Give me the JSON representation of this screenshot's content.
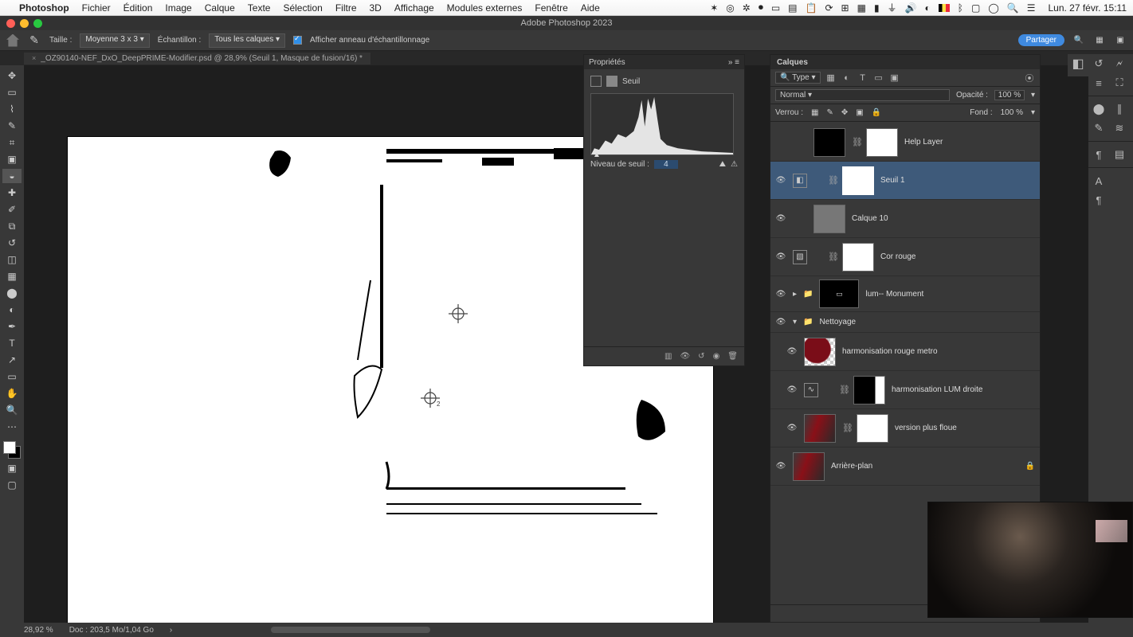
{
  "menubar": {
    "app": "Photoshop",
    "items": [
      "Fichier",
      "Édition",
      "Image",
      "Calque",
      "Texte",
      "Sélection",
      "Filtre",
      "3D",
      "Affichage",
      "Modules externes",
      "Fenêtre",
      "Aide"
    ],
    "clock": "Lun. 27 févr. 15:11"
  },
  "app_title": "Adobe Photoshop 2023",
  "optbar": {
    "taille_label": "Taille :",
    "taille_value": "Moyenne 3 x 3",
    "echant_label": "Échantillon :",
    "echant_value": "Tous les calques",
    "ring_label": "Afficher anneau d'échantillonnage",
    "share": "Partager"
  },
  "doc_tab": "_OZ90140-NEF_DxO_DeepPRIME-Modifier.psd @ 28,9% (Seuil 1, Masque de fusion/16) *",
  "status": {
    "zoom": "28,92 %",
    "doc": "Doc : 203,5 Mo/1,04 Go"
  },
  "props": {
    "title": "Propriétés",
    "adj_name": "Seuil",
    "thr_label": "Niveau de seuil :",
    "thr_value": "4"
  },
  "layers": {
    "title": "Calques",
    "type_label": "Type",
    "blend": "Normal",
    "opacity_label": "Opacité :",
    "opacity_value": "100 %",
    "lock_label": "Verrou :",
    "fill_label": "Fond :",
    "fill_value": "100 %",
    "items": [
      {
        "name": "Help Layer",
        "vis": false,
        "adj": false,
        "mask": true,
        "thumb": "black"
      },
      {
        "name": "Seuil 1",
        "vis": true,
        "adj": true,
        "mask": true,
        "selected": true,
        "thumb": "white"
      },
      {
        "name": "Calque 10",
        "vis": true,
        "adj": false,
        "mask": false,
        "thumb": "grey"
      },
      {
        "name": "Cor rouge",
        "vis": true,
        "adj": true,
        "mask": true,
        "thumb": "white"
      },
      {
        "name": "lum-- Monument",
        "vis": true,
        "group": true,
        "mask_black": true
      },
      {
        "name": "Nettoyage",
        "vis": true,
        "group": true
      },
      {
        "name": "harmonisation rouge metro",
        "vis": true,
        "thumb": "red"
      },
      {
        "name": "harmonisation LUM droite",
        "vis": true,
        "adj": true,
        "mask_black_r": true
      },
      {
        "name": "version plus floue",
        "vis": true,
        "mask": true,
        "thumb": "img"
      },
      {
        "name": "Arrière-plan",
        "vis": true,
        "locked": true,
        "thumb": "img"
      }
    ]
  }
}
